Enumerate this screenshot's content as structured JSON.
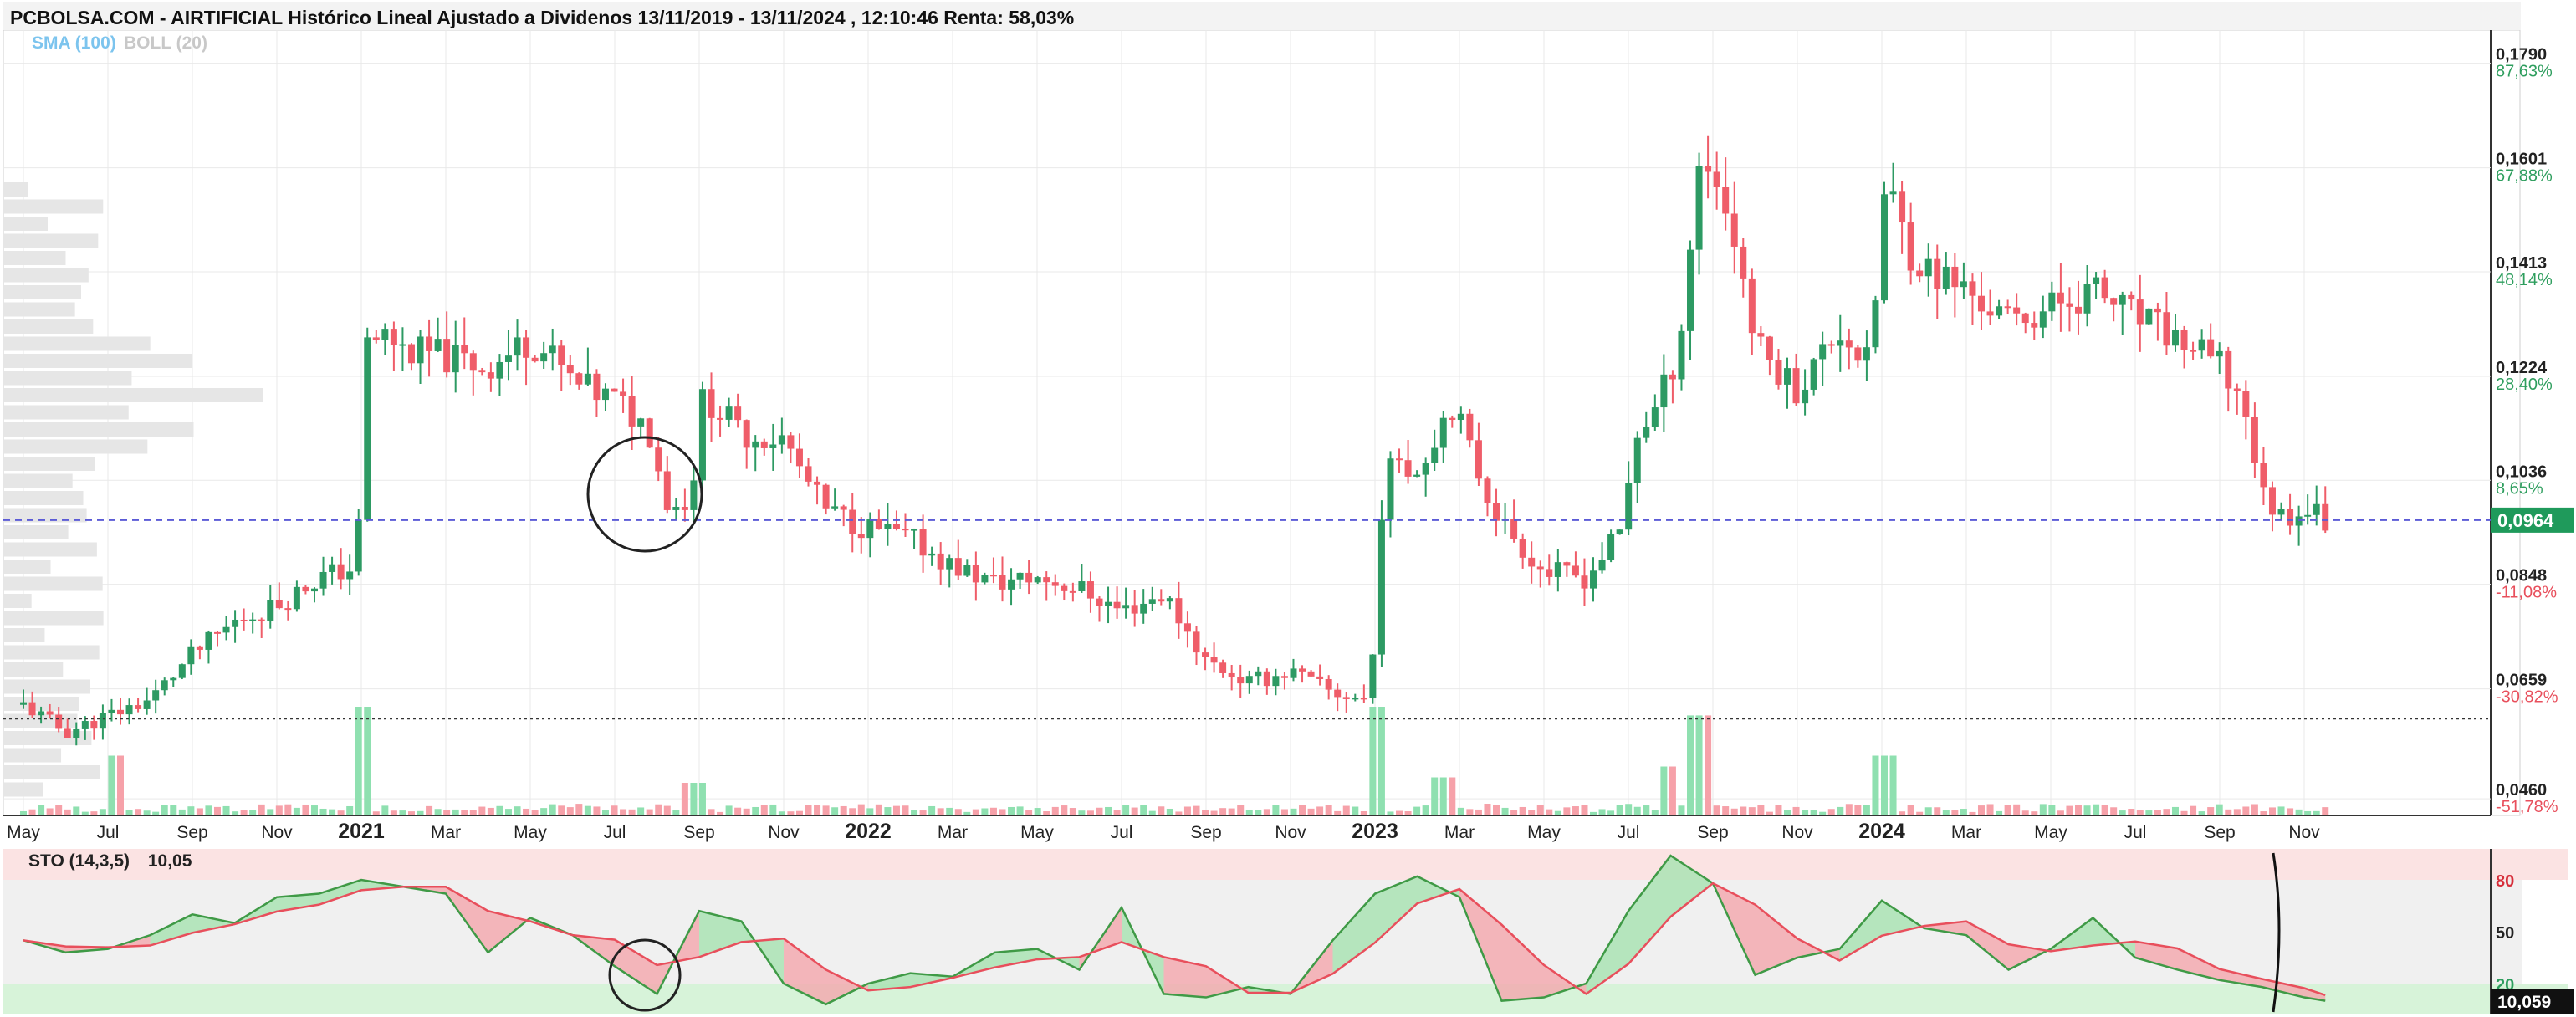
{
  "title": "PCBOLSA.COM - AIRTIFICIAL Histórico Lineal Ajustado a Dividenos 13/11/2019 - 13/11/2024 , 12:10:46 Renta: 58,03%",
  "indicators": [
    {
      "label": "SMA (100)",
      "color": "#7cc4ee"
    },
    {
      "label": "BOLL (20)",
      "color": "#c8c8c8"
    }
  ],
  "chart_data": {
    "type": "candlestick",
    "ylim": [
      0.043,
      0.185
    ],
    "x_ticks": [
      {
        "label": "May",
        "month": 0,
        "bold": false
      },
      {
        "label": "Jul",
        "month": 2,
        "bold": false
      },
      {
        "label": "Sep",
        "month": 4,
        "bold": false
      },
      {
        "label": "Nov",
        "month": 6,
        "bold": false
      },
      {
        "label": "2021",
        "month": 8,
        "bold": true
      },
      {
        "label": "Mar",
        "month": 10,
        "bold": false
      },
      {
        "label": "May",
        "month": 12,
        "bold": false
      },
      {
        "label": "Jul",
        "month": 14,
        "bold": false
      },
      {
        "label": "Sep",
        "month": 16,
        "bold": false
      },
      {
        "label": "Nov",
        "month": 18,
        "bold": false
      },
      {
        "label": "2022",
        "month": 20,
        "bold": true
      },
      {
        "label": "Mar",
        "month": 22,
        "bold": false
      },
      {
        "label": "May",
        "month": 24,
        "bold": false
      },
      {
        "label": "Jul",
        "month": 26,
        "bold": false
      },
      {
        "label": "Sep",
        "month": 28,
        "bold": false
      },
      {
        "label": "Nov",
        "month": 30,
        "bold": false
      },
      {
        "label": "2023",
        "month": 32,
        "bold": true
      },
      {
        "label": "Mar",
        "month": 34,
        "bold": false
      },
      {
        "label": "May",
        "month": 36,
        "bold": false
      },
      {
        "label": "Jul",
        "month": 38,
        "bold": false
      },
      {
        "label": "Sep",
        "month": 40,
        "bold": false
      },
      {
        "label": "Nov",
        "month": 42,
        "bold": false
      },
      {
        "label": "2024",
        "month": 44,
        "bold": true
      },
      {
        "label": "Mar",
        "month": 46,
        "bold": false
      },
      {
        "label": "May",
        "month": 48,
        "bold": false
      },
      {
        "label": "Jul",
        "month": 50,
        "bold": false
      },
      {
        "label": "Sep",
        "month": 52,
        "bold": false
      },
      {
        "label": "Nov",
        "month": 54,
        "bold": false
      }
    ],
    "y_ticks": [
      {
        "price": 0.179,
        "price_label": "0,1790",
        "pct_label": "87,63%",
        "pct_color": "#2e9e5e"
      },
      {
        "price": 0.1601,
        "price_label": "0,1601",
        "pct_label": "67,88%",
        "pct_color": "#2e9e5e"
      },
      {
        "price": 0.1413,
        "price_label": "0,1413",
        "pct_label": "48,14%",
        "pct_color": "#2e9e5e"
      },
      {
        "price": 0.1224,
        "price_label": "0,1224",
        "pct_label": "28,40%",
        "pct_color": "#2e9e5e"
      },
      {
        "price": 0.1036,
        "price_label": "0,1036",
        "pct_label": "8,65%",
        "pct_color": "#2e9e5e"
      },
      {
        "price": 0.0848,
        "price_label": "0,0848",
        "pct_label": "-11,08%",
        "pct_color": "#e84f5c"
      },
      {
        "price": 0.0659,
        "price_label": "0,0659",
        "pct_label": "-30,82%",
        "pct_color": "#e84f5c"
      },
      {
        "price": 0.046,
        "price_label": "0,0460",
        "pct_label": "-51,78%",
        "pct_color": "#e84f5c"
      }
    ],
    "current_price": {
      "value": 0.0964,
      "label": "0,0964"
    },
    "base_price": 0.0605,
    "price_path": [
      [
        0,
        0.063
      ],
      [
        1,
        0.058
      ],
      [
        2,
        0.061
      ],
      [
        3,
        0.064
      ],
      [
        4,
        0.072
      ],
      [
        5,
        0.078
      ],
      [
        6,
        0.081
      ],
      [
        7,
        0.086
      ],
      [
        7.9,
        0.088
      ],
      [
        8.1,
        0.128
      ],
      [
        8.6,
        0.13
      ],
      [
        9,
        0.127
      ],
      [
        10,
        0.126
      ],
      [
        11,
        0.124
      ],
      [
        12,
        0.129
      ],
      [
        12.6,
        0.125
      ],
      [
        13,
        0.121
      ],
      [
        14,
        0.118
      ],
      [
        14.8,
        0.113
      ],
      [
        15.3,
        0.098
      ],
      [
        15.8,
        0.101
      ],
      [
        16.1,
        0.119
      ],
      [
        17,
        0.112
      ],
      [
        18,
        0.111
      ],
      [
        18.5,
        0.104
      ],
      [
        19,
        0.098
      ],
      [
        20,
        0.095
      ],
      [
        21,
        0.093
      ],
      [
        22,
        0.088
      ],
      [
        23,
        0.085
      ],
      [
        24,
        0.086
      ],
      [
        25,
        0.084
      ],
      [
        26,
        0.08
      ],
      [
        27,
        0.083
      ],
      [
        28,
        0.071
      ],
      [
        29,
        0.067
      ],
      [
        30,
        0.069
      ],
      [
        31,
        0.065
      ],
      [
        31.9,
        0.064
      ],
      [
        32.1,
        0.097
      ],
      [
        32.5,
        0.109
      ],
      [
        33,
        0.105
      ],
      [
        33.8,
        0.118
      ],
      [
        34.5,
        0.104
      ],
      [
        35,
        0.096
      ],
      [
        36,
        0.087
      ],
      [
        37,
        0.086
      ],
      [
        37.8,
        0.094
      ],
      [
        38.2,
        0.112
      ],
      [
        38.7,
        0.117
      ],
      [
        39.2,
        0.128
      ],
      [
        39.7,
        0.162
      ],
      [
        40,
        0.16
      ],
      [
        40.6,
        0.145
      ],
      [
        41,
        0.128
      ],
      [
        42,
        0.12
      ],
      [
        43,
        0.131
      ],
      [
        43.7,
        0.124
      ],
      [
        44.1,
        0.158
      ],
      [
        44.6,
        0.146
      ],
      [
        45,
        0.142
      ],
      [
        46,
        0.138
      ],
      [
        47,
        0.132
      ],
      [
        48,
        0.135
      ],
      [
        49,
        0.138
      ],
      [
        50,
        0.133
      ],
      [
        51,
        0.129
      ],
      [
        52,
        0.124
      ],
      [
        52.6,
        0.117
      ],
      [
        53,
        0.101
      ],
      [
        53.5,
        0.097
      ],
      [
        54,
        0.099
      ],
      [
        54.5,
        0.0964
      ]
    ],
    "volume_spikes": [
      [
        8.1,
        1.0
      ],
      [
        32.1,
        1.0
      ],
      [
        33.6,
        0.35
      ],
      [
        39.7,
        0.92
      ],
      [
        44.1,
        0.55
      ],
      [
        2.2,
        0.55
      ],
      [
        15.9,
        0.3
      ],
      [
        38.9,
        0.45
      ]
    ],
    "stochastic": {
      "label": "STO (14,3,5)",
      "value_text": "10,05",
      "last_label": "10,059",
      "levels": [
        {
          "value": 80,
          "label": "80"
        },
        {
          "value": 50,
          "label": "50"
        },
        {
          "value": 20,
          "label": "20"
        }
      ],
      "k": [
        [
          0,
          45
        ],
        [
          1,
          38
        ],
        [
          2,
          40
        ],
        [
          3,
          48
        ],
        [
          4,
          60
        ],
        [
          5,
          55
        ],
        [
          6,
          70
        ],
        [
          7,
          72
        ],
        [
          8,
          80
        ],
        [
          9,
          76
        ],
        [
          10,
          72
        ],
        [
          11,
          38
        ],
        [
          12,
          58
        ],
        [
          13,
          48
        ],
        [
          14,
          30
        ],
        [
          15,
          14
        ],
        [
          16,
          62
        ],
        [
          17,
          56
        ],
        [
          18,
          20
        ],
        [
          19,
          8
        ],
        [
          20,
          20
        ],
        [
          21,
          26
        ],
        [
          22,
          24
        ],
        [
          23,
          38
        ],
        [
          24,
          40
        ],
        [
          25,
          28
        ],
        [
          26,
          64
        ],
        [
          27,
          14
        ],
        [
          28,
          12
        ],
        [
          29,
          18
        ],
        [
          30,
          14
        ],
        [
          31,
          45
        ],
        [
          32,
          72
        ],
        [
          33,
          82
        ],
        [
          34,
          70
        ],
        [
          35,
          10
        ],
        [
          36,
          12
        ],
        [
          37,
          20
        ],
        [
          38,
          62
        ],
        [
          39,
          94
        ],
        [
          40,
          78
        ],
        [
          41,
          25
        ],
        [
          42,
          35
        ],
        [
          43,
          40
        ],
        [
          44,
          68
        ],
        [
          45,
          52
        ],
        [
          46,
          48
        ],
        [
          47,
          28
        ],
        [
          48,
          40
        ],
        [
          49,
          58
        ],
        [
          50,
          35
        ],
        [
          51,
          28
        ],
        [
          52,
          22
        ],
        [
          53,
          18
        ],
        [
          54,
          12
        ],
        [
          54.5,
          10
        ]
      ]
    }
  }
}
